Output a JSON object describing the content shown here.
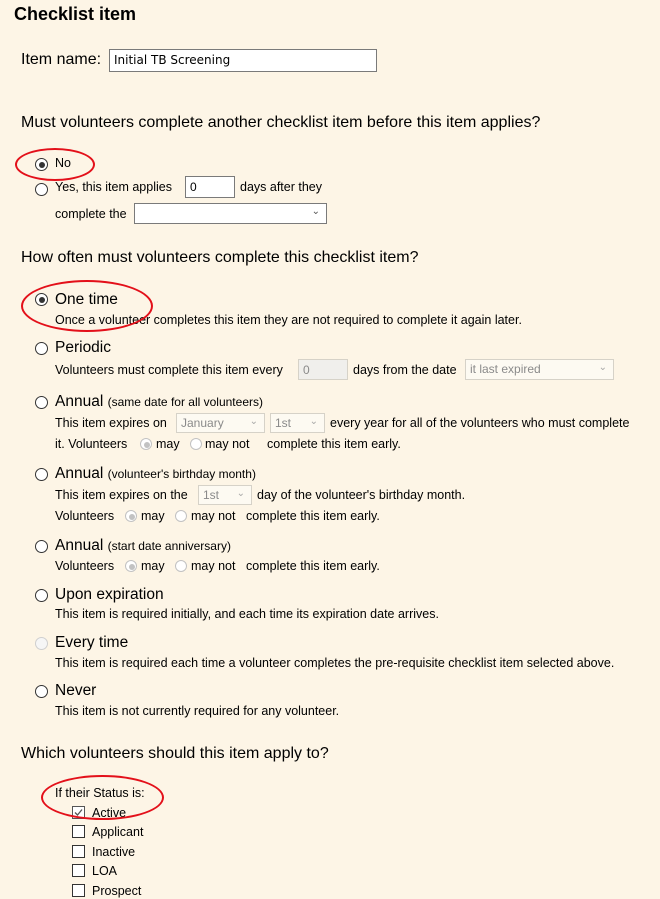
{
  "header": {
    "title": "Checklist item"
  },
  "item_name": {
    "label": "Item name:",
    "value": "Initial TB Screening"
  },
  "prereq": {
    "question": "Must volunteers complete another checklist item before this item applies?",
    "no_label": "No",
    "yes_label_prefix": "Yes, this item applies",
    "days_value": "0",
    "yes_label_suffix": "days after they",
    "complete_the_label": "complete the",
    "item_select_value": "",
    "selected": "No"
  },
  "frequency": {
    "question": "How often must volunteers complete this checklist item?",
    "selected": "One time",
    "options": [
      {
        "label": "One time",
        "desc": "Once a volunteer completes this item they are not required to complete it again later."
      },
      {
        "label": "Periodic",
        "desc_prefix": "Volunteers must complete this item every",
        "days_value": "0",
        "desc_mid": "days from the date",
        "from_select": "it last expired"
      },
      {
        "label": "Annual",
        "sub": "(same date for all volunteers)",
        "desc_prefix": "This item expires on",
        "month_select": "January",
        "day_select": "1st",
        "desc_suffix": "every year for all of the volunteers who must complete",
        "early_prefix": "it. Volunteers",
        "may": "may",
        "may_not": "may not",
        "early_suffix": "complete this item early."
      },
      {
        "label": "Annual",
        "sub": "(volunteer's birthday month)",
        "desc_prefix": "This item expires on the",
        "day_select": "1st",
        "desc_suffix": "day of the volunteer's birthday month.",
        "early_prefix": "Volunteers",
        "may": "may",
        "may_not": "may not",
        "early_suffix": "complete this item early."
      },
      {
        "label": "Annual",
        "sub": "(start date anniversary)",
        "early_prefix": "Volunteers",
        "may": "may",
        "may_not": "may not",
        "early_suffix": "complete this item early."
      },
      {
        "label": "Upon expiration",
        "desc": "This item is required initially, and each time its expiration date arrives."
      },
      {
        "label": "Every time",
        "desc": "This item is required each time a volunteer completes the pre-requisite checklist item selected above.",
        "disabled": true
      },
      {
        "label": "Never",
        "desc": "This item is not currently required for any volunteer."
      }
    ]
  },
  "apply_to": {
    "question": "Which volunteers should this item apply to?",
    "status_label": "If their Status is:",
    "statuses": [
      {
        "label": "Active",
        "checked": true
      },
      {
        "label": "Applicant",
        "checked": false
      },
      {
        "label": "Inactive",
        "checked": false
      },
      {
        "label": "LOA",
        "checked": false
      },
      {
        "label": "Prospect",
        "checked": false
      }
    ]
  },
  "annotation_color": "#e3101a"
}
